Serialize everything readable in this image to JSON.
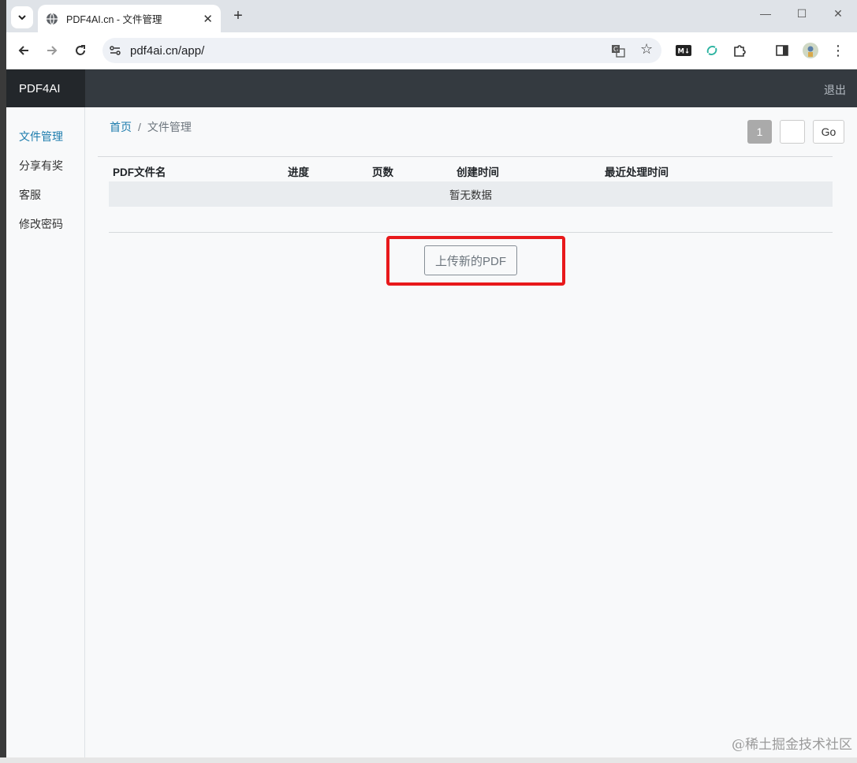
{
  "browser": {
    "tab_title": "PDF4AI.cn - 文件管理",
    "url": "pdf4ai.cn/app/"
  },
  "app": {
    "brand": "PDF4AI",
    "logout": "退出",
    "sidebar": [
      {
        "label": "文件管理",
        "active": true
      },
      {
        "label": "分享有奖",
        "active": false
      },
      {
        "label": "客服",
        "active": false
      },
      {
        "label": "修改密码",
        "active": false
      }
    ],
    "breadcrumb": {
      "home": "首页",
      "sep": "/",
      "current": "文件管理"
    },
    "pager": {
      "current": "1",
      "go": "Go"
    },
    "table": {
      "columns": [
        "PDF文件名",
        "进度",
        "页数",
        "创建时间",
        "最近处理时间"
      ],
      "empty": "暂无数据"
    },
    "upload_button": "上传新的PDF"
  },
  "watermark": "@稀土掘金技术社区",
  "colors": {
    "accent": "#1c7cad",
    "appbar": "#343a40",
    "highlight": "#e8191b"
  }
}
